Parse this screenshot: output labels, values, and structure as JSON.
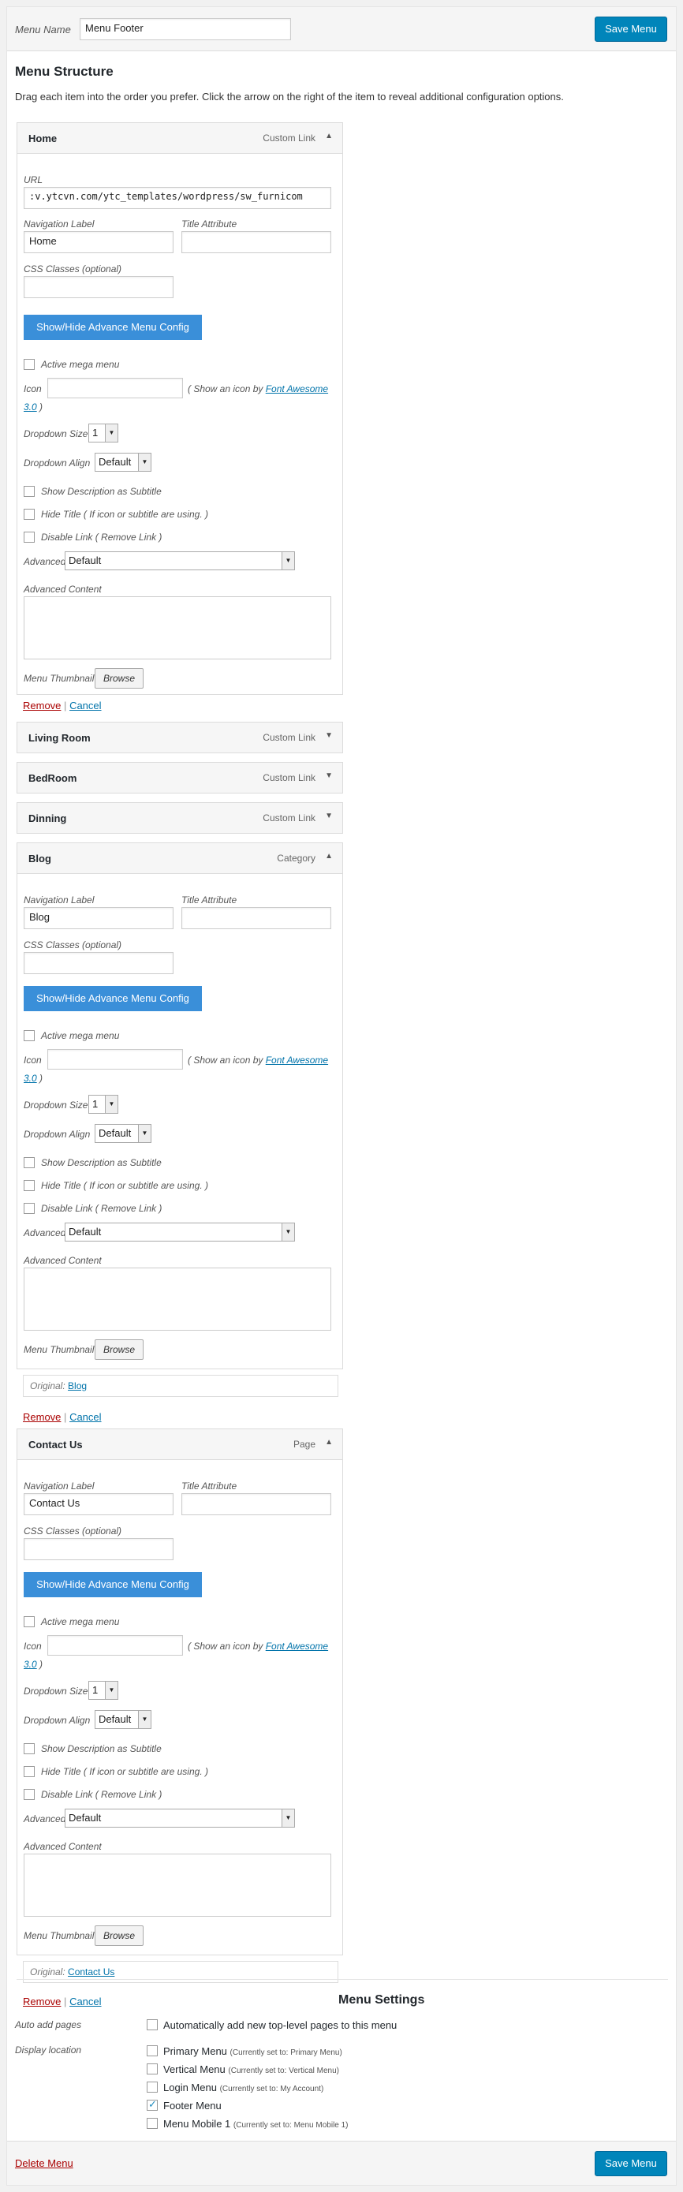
{
  "header": {
    "menu_name_label": "Menu Name",
    "menu_name_value": "Menu Footer",
    "save_label": "Save Menu"
  },
  "structure": {
    "title": "Menu Structure",
    "description": "Drag each item into the order you prefer. Click the arrow on the right of the item to reveal additional configuration options."
  },
  "labels": {
    "url": "URL",
    "nav_label": "Navigation Label",
    "title_attr": "Title Attribute",
    "css_classes": "CSS Classes (optional)",
    "toggle_btn": "Show/Hide Advance Menu Config",
    "active_mega": "Active mega menu",
    "icon": "Icon",
    "icon_hint_pre": "( Show an icon by ",
    "icon_hint_link": "Font Awesome",
    "icon_hint_version": "3.0",
    "icon_hint_post": " )",
    "dropdown_size": "Dropdown Size",
    "dropdown_size_value": "1",
    "dropdown_align": "Dropdown Align",
    "dropdown_align_value": "Default",
    "show_desc": "Show Description as Subtitle",
    "hide_title": "Hide Title ( If icon or subtitle are using. )",
    "disable_link": "Disable Link ( Remove Link )",
    "advanced": "Advanced",
    "advanced_value": "Default",
    "advanced_content": "Advanced Content",
    "menu_thumbnail": "Menu Thumbnail",
    "browse": "Browse",
    "remove": "Remove",
    "sep": "|",
    "cancel": "Cancel",
    "original": "Original:"
  },
  "items": [
    {
      "title": "Home",
      "type": "Custom Link",
      "expanded": true,
      "url": ":v.ytcvn.com/ytc_templates/wordpress/sw_furnicom",
      "nav_label": "Home"
    },
    {
      "title": "Living Room",
      "type": "Custom Link",
      "expanded": false
    },
    {
      "title": "BedRoom",
      "type": "Custom Link",
      "expanded": false
    },
    {
      "title": "Dinning",
      "type": "Custom Link",
      "expanded": false
    },
    {
      "title": "Blog",
      "type": "Category",
      "expanded": true,
      "nav_label": "Blog",
      "original": "Blog"
    },
    {
      "title": "Contact Us",
      "type": "Page",
      "expanded": true,
      "nav_label": "Contact Us",
      "original": "Contact Us"
    }
  ],
  "menu_settings": {
    "title": "Menu Settings",
    "auto_add_label": "Auto add pages",
    "auto_add_text": "Automatically add new top-level pages to this menu",
    "display_location_label": "Display location",
    "locations": [
      {
        "name": "Primary Menu",
        "note": "(Currently set to: Primary Menu)",
        "checked": false
      },
      {
        "name": "Vertical Menu",
        "note": "(Currently set to: Vertical Menu)",
        "checked": false
      },
      {
        "name": "Login Menu",
        "note": "(Currently set to: My Account)",
        "checked": false
      },
      {
        "name": "Footer Menu",
        "note": "",
        "checked": true
      },
      {
        "name": "Menu Mobile 1",
        "note": "(Currently set to: Menu Mobile 1)",
        "checked": false
      }
    ]
  },
  "footer": {
    "delete_label": "Delete Menu",
    "save_label": "Save Menu"
  },
  "icons": {
    "collapse": "arrow-up-icon",
    "expand": "arrow-down-icon",
    "select": "chevron-down-icon"
  }
}
